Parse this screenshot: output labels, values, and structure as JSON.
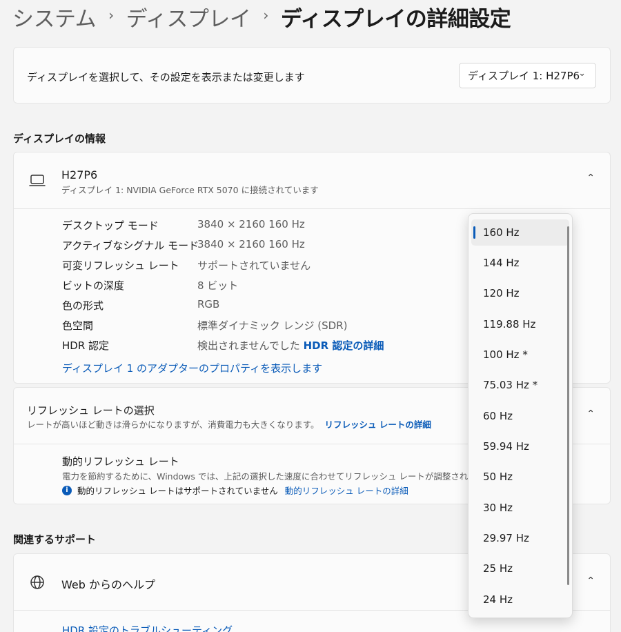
{
  "breadcrumb": {
    "items": [
      "システム",
      "ディスプレイ"
    ],
    "current": "ディスプレイの詳細設定",
    "separator": "›"
  },
  "selector": {
    "text": "ディスプレイを選択して、その設定を表示または変更します",
    "value": "ディスプレイ 1: H27P6"
  },
  "display_info": {
    "section_title": "ディスプレイの情報",
    "monitor_name": "H27P6",
    "monitor_sub": "ディスプレイ 1: NVIDIA GeForce RTX 5070 に接続されています",
    "rows": [
      {
        "label": "デスクトップ モード",
        "value": "3840 × 2160 160 Hz"
      },
      {
        "label": "アクティブなシグナル モード",
        "value": "3840 × 2160 160 Hz"
      },
      {
        "label": "可変リフレッシュ レート",
        "value": "サポートされていません"
      },
      {
        "label": "ビットの深度",
        "value": "8 ビット"
      },
      {
        "label": "色の形式",
        "value": "RGB"
      },
      {
        "label": "色空間",
        "value": "標準ダイナミック レンジ (SDR)"
      },
      {
        "label": "HDR 認定",
        "value": "検出されませんでした"
      }
    ],
    "hdr_link": "HDR 認定の詳細",
    "adapter_link": "ディスプレイ 1 のアダプターのプロパティを表示します"
  },
  "refresh": {
    "title": "リフレッシュ レートの選択",
    "description": "レートが高いほど動きは滑らかになりますが、消費電力も大きくなります。",
    "link": "リフレッシュ レートの詳細",
    "dynamic_title": "動的リフレッシュ レート",
    "dynamic_desc": "電力を節約するために、Windows では、上記の選択した速度に合わせてリフレッシュ レートが調整されます",
    "dynamic_note": "動的リフレッシュ レートはサポートされていません",
    "dynamic_link": "動的リフレッシュ レートの詳細"
  },
  "support": {
    "section_title": "関連するサポート",
    "help_title": "Web からのヘルプ",
    "help_link": "HDR 設定のトラブルシューティング"
  },
  "dropdown": {
    "selected": "160 Hz",
    "options": [
      "160 Hz",
      "144 Hz",
      "120 Hz",
      "119.88 Hz",
      "100 Hz *",
      "75.03 Hz *",
      "60 Hz",
      "59.94 Hz",
      "50 Hz",
      "30 Hz",
      "29.97 Hz",
      "25 Hz",
      "24 Hz"
    ]
  },
  "icons": {
    "chevron": "chevron-down-icon",
    "collapse": "chevron-up-icon",
    "monitor": "laptop-icon",
    "help": "globe-icon",
    "info": "info-icon"
  },
  "colors": {
    "accent": "#0a5bb8",
    "background": "#f3f3f3",
    "card": "#fbfbfb"
  }
}
